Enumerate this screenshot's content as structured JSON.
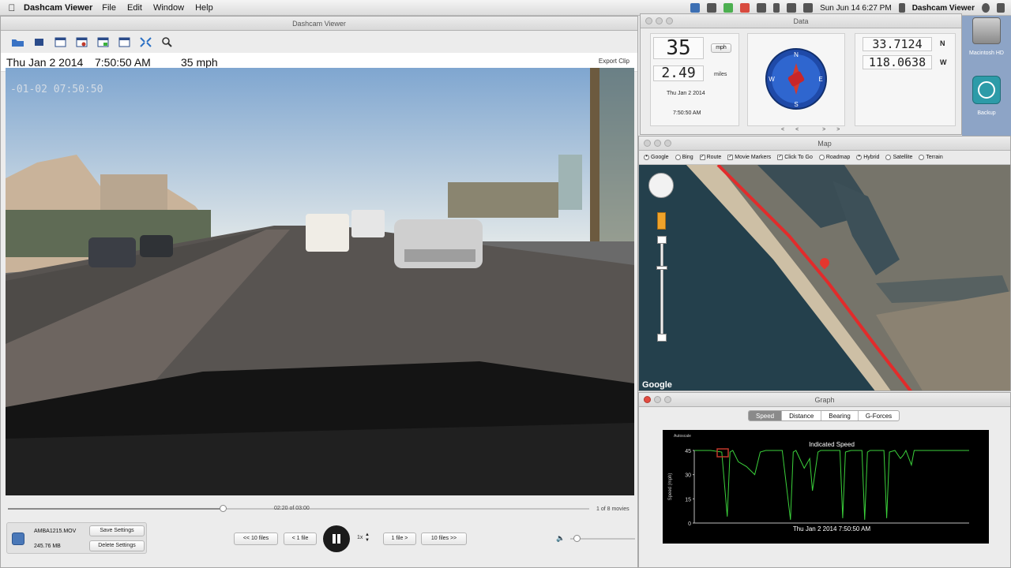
{
  "menubar": {
    "apple": "",
    "app_name": "Dashcam Viewer",
    "items": [
      "File",
      "Edit",
      "Window",
      "Help"
    ],
    "clock": "Sun Jun 14  6:27 PM",
    "active_app": "Dashcam Viewer"
  },
  "main": {
    "title": "Dashcam Viewer",
    "date": "Thu Jan 2 2014",
    "time": "7:50:50 AM",
    "speed": "35 mph",
    "export": "Export Clip",
    "stamp": "-01-02 07:50:50",
    "time_position": "02:20 of 03:00",
    "movie_count": "1 of 8 movies",
    "progress": 0.37,
    "file_name": "AMBA1215.MOV",
    "file_size": "245.76 MB",
    "save_settings": "Save Settings",
    "delete_settings": "Delete Settings",
    "nav": [
      "<< 10 files",
      "< 1 file",
      "1 file >",
      "10 files >>"
    ],
    "rate": "1x",
    "volume": 0.1
  },
  "data": {
    "title": "Data",
    "speed": "35",
    "speed_unit": "mph",
    "distance": "2.49",
    "distance_unit": "miles",
    "date": "Thu Jan 2 2014",
    "time": "7:50:50 AM",
    "lat": "33.7124",
    "lat_dir": "N",
    "lon": "118.0638",
    "lon_dir": "W",
    "compass_nav": "<< >>",
    "compass": {
      "n": "N",
      "s": "S",
      "e": "E",
      "w": "W"
    }
  },
  "map": {
    "title": "Map",
    "options": [
      {
        "label": "Google",
        "type": "radio",
        "checked": true
      },
      {
        "label": "Bing",
        "type": "radio",
        "checked": false
      },
      {
        "label": "Route",
        "type": "check",
        "checked": true
      },
      {
        "label": "Movie Markers",
        "type": "check",
        "checked": true
      },
      {
        "label": "Click To Go",
        "type": "check",
        "checked": true
      },
      {
        "label": "Roadmap",
        "type": "radio",
        "checked": false
      },
      {
        "label": "Hybrid",
        "type": "radio",
        "checked": true
      },
      {
        "label": "Satellite",
        "type": "radio",
        "checked": false
      },
      {
        "label": "Terrain",
        "type": "radio",
        "checked": false
      }
    ],
    "logo": "Google"
  },
  "graph": {
    "title": "Graph",
    "tabs": [
      "Speed",
      "Distance",
      "Bearing",
      "G-Forces"
    ],
    "active_tab": "Speed",
    "corner": "Autoscale",
    "colors": {
      "line": "#3bd13b",
      "bg": "#000000",
      "cursor": "#c0392b"
    }
  },
  "chart_data": {
    "type": "line",
    "title": "Indicated Speed",
    "xlabel": "Thu Jan 2 2014   7:50:50 AM",
    "ylabel": "Speed (mph)",
    "ylim": [
      0,
      45
    ],
    "yticks": [
      0,
      15,
      30,
      45
    ],
    "grid": false,
    "series": [
      {
        "x": [
          0,
          6,
          10,
          12,
          13,
          14,
          16,
          19,
          22,
          24,
          26,
          28,
          32,
          35,
          36,
          37,
          40,
          42,
          43,
          45,
          46,
          47,
          48,
          50,
          53,
          54,
          55,
          57,
          61,
          62,
          63,
          64,
          66,
          69,
          70,
          71,
          73,
          75,
          76,
          77,
          79,
          80,
          83,
          100
        ],
        "y": [
          45,
          45,
          44,
          4,
          44,
          45,
          38,
          35,
          30,
          44,
          45,
          45,
          45,
          2,
          44,
          45,
          34,
          40,
          20,
          44,
          45,
          45,
          45,
          45,
          45,
          3,
          44,
          45,
          45,
          2,
          44,
          45,
          45,
          45,
          3,
          44,
          45,
          40,
          42,
          45,
          36,
          45,
          45,
          45
        ]
      }
    ]
  },
  "desktop": {
    "hd_label": "Macintosh HD",
    "backup_label": "Backup"
  }
}
